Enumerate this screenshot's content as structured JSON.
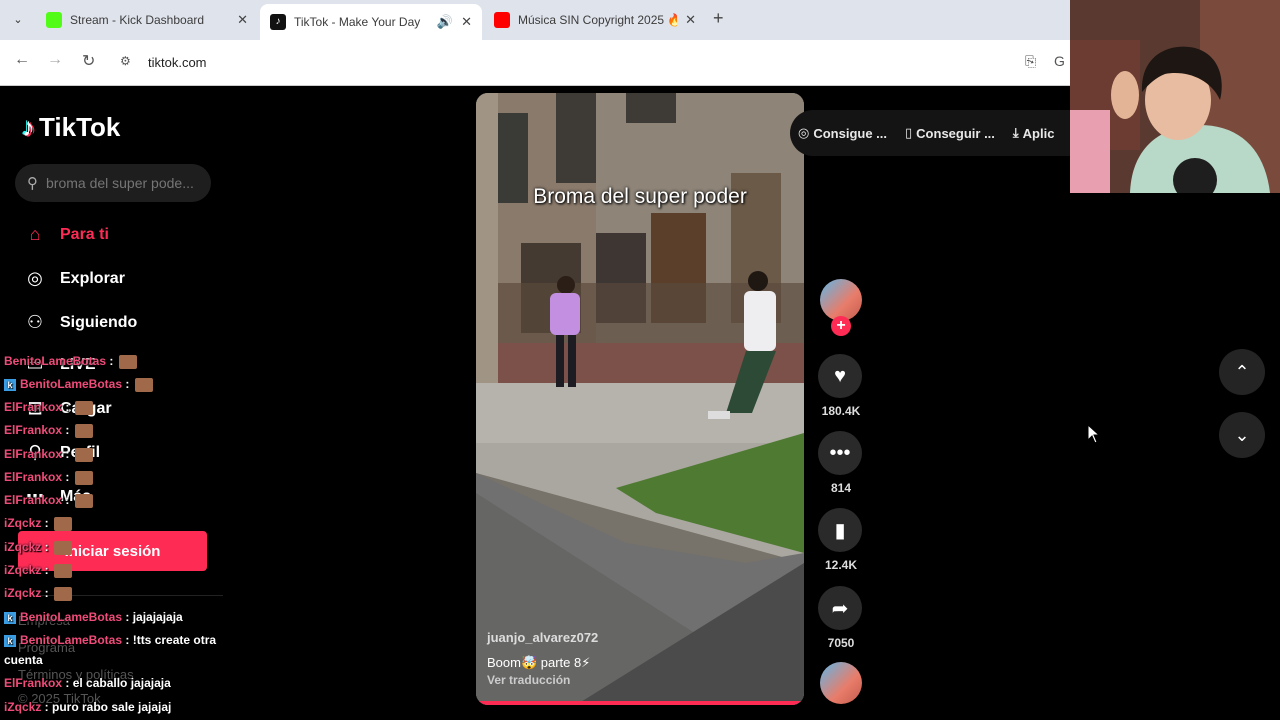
{
  "browser": {
    "tabs": [
      {
        "title": "Stream - Kick Dashboard",
        "favicon_color": "#53fc18",
        "active": false
      },
      {
        "title": "TikTok - Make Your Day",
        "favicon_color": "#111111",
        "active": true
      },
      {
        "title": "Música SIN Copyright 2025 🔥",
        "favicon_color": "#ff0000",
        "active": false
      }
    ],
    "url": "tiktok.com"
  },
  "sidebar": {
    "brand": "TikTok",
    "search_placeholder": "broma del super pode...",
    "nav_items": [
      {
        "label": "Para ti",
        "icon": "home-icon",
        "active": true
      },
      {
        "label": "Explorar",
        "icon": "compass-icon",
        "active": false
      },
      {
        "label": "Siguiendo",
        "icon": "following-icon",
        "active": false
      },
      {
        "label": "LIVE",
        "icon": "live-icon",
        "active": false
      },
      {
        "label": "Cargar",
        "icon": "upload-icon",
        "active": false
      },
      {
        "label": "Perfil",
        "icon": "profile-icon",
        "active": false
      },
      {
        "label": "Más",
        "icon": "more-icon",
        "active": false
      }
    ],
    "login_label": "Iniciar sesión",
    "footer": [
      "Empresa",
      "Programa",
      "Términos y políticas",
      "© 2025 TikTok"
    ]
  },
  "chat_overlay": [
    {
      "user": "BenitoLameBotas",
      "message": " : ",
      "badge": false,
      "emote": true
    },
    {
      "user": "BenitoLameBotas",
      "message": " : ",
      "badge": true,
      "emote": true
    },
    {
      "user": "ElFrankox",
      "message": " : ",
      "badge": false,
      "emote": true
    },
    {
      "user": "ElFrankox",
      "message": " : ",
      "badge": false,
      "emote": true
    },
    {
      "user": "ElFrankox",
      "message": " : ",
      "badge": false,
      "emote": true
    },
    {
      "user": "ElFrankox",
      "message": " : ",
      "badge": false,
      "emote": true
    },
    {
      "user": "ElFrankox",
      "message": " : ",
      "badge": false,
      "emote": true
    },
    {
      "user": "iZqckz",
      "message": " : ",
      "badge": false,
      "emote": true
    },
    {
      "user": "iZqckz",
      "message": " : ",
      "badge": false,
      "emote": true
    },
    {
      "user": "iZqckz",
      "message": " : ",
      "badge": false,
      "emote": true
    },
    {
      "user": "iZqckz",
      "message": " : ",
      "badge": false,
      "emote": true
    },
    {
      "user": "BenitoLameBotas",
      "message": " : jajajajaja",
      "badge": true,
      "emote": false
    },
    {
      "user": "BenitoLameBotas",
      "message": " : !tts create otra",
      "badge": true,
      "emote": false
    },
    {
      "user": "",
      "message": "cuenta",
      "badge": false,
      "emote": false
    },
    {
      "user": "ElFrankox",
      "message": " : el caballo jajajaja",
      "badge": false,
      "emote": false
    },
    {
      "user": "iZqckz",
      "message": " : puro rabo sale jajajaj",
      "badge": false,
      "emote": false
    }
  ],
  "video": {
    "caption_overlay": "Broma del super poder",
    "author": "juanjo_alvarez072",
    "description": "Boom🤯 parte 8⚡",
    "translate_label": "Ver traducción",
    "progress": 1.0
  },
  "actions": {
    "likes": "180.4K",
    "comments": "814",
    "saves": "12.4K",
    "shares": "7050"
  },
  "top_chips": [
    {
      "label": "Consigue ...",
      "icon": "coin-icon"
    },
    {
      "label": "Conseguir ...",
      "icon": "phone-icon"
    },
    {
      "label": "Aplic",
      "icon": "download-icon"
    }
  ],
  "colors": {
    "accent": "#fe2c55",
    "background": "#000000"
  }
}
